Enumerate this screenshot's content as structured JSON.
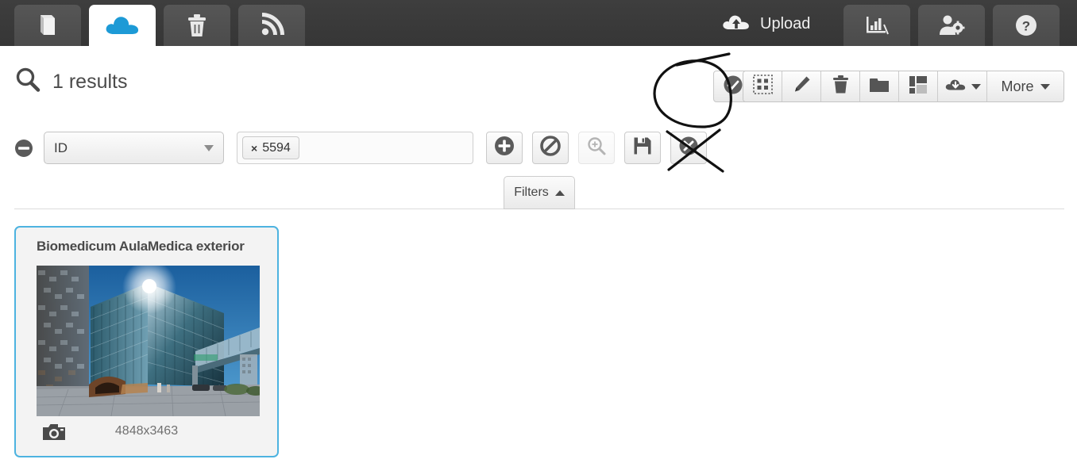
{
  "topbar": {
    "tabs_left": [
      {
        "name": "book-tab",
        "icon": "book-icon",
        "active": false
      },
      {
        "name": "cloud-tab",
        "icon": "cloud-icon",
        "active": true
      },
      {
        "name": "trash-tab",
        "icon": "trash-icon",
        "active": false
      },
      {
        "name": "feed-tab",
        "icon": "rss-icon",
        "active": false
      }
    ],
    "upload_label": "Upload",
    "upload_icon": "cloud-upload-icon",
    "tabs_right": [
      {
        "name": "stats-tab",
        "icon": "bar-chart-icon"
      },
      {
        "name": "users-tab",
        "icon": "user-settings-icon"
      },
      {
        "name": "help-tab",
        "icon": "question-circle-icon"
      }
    ]
  },
  "results": {
    "search_icon": "search-icon",
    "count_label": "1 results"
  },
  "toolbar": {
    "check_button": {
      "label": "",
      "icon": "check-circle-icon"
    },
    "buttons": [
      {
        "name": "select-all-button",
        "icon": "select-grid-icon",
        "label": ""
      },
      {
        "name": "edit-button",
        "icon": "pencil-icon",
        "label": ""
      },
      {
        "name": "delete-button",
        "icon": "trash-icon",
        "label": ""
      },
      {
        "name": "folder-button",
        "icon": "folder-icon",
        "label": ""
      },
      {
        "name": "layout-button",
        "icon": "collage-layout-icon",
        "label": ""
      },
      {
        "name": "download-dropdown",
        "icon": "cloud-download-icon",
        "label": ""
      },
      {
        "name": "more-dropdown",
        "icon": "caret-down-icon",
        "label": "More"
      }
    ]
  },
  "filters": {
    "remove_icon": "minus-circle-icon",
    "field_select": {
      "value": "ID",
      "caret": "caret-down-icon"
    },
    "tag_input": {
      "tags": [
        {
          "remove": "×",
          "label": "5594"
        }
      ],
      "placeholder": ""
    },
    "actions": [
      {
        "name": "add-filter-button",
        "icon": "plus-circle-icon",
        "disabled": false
      },
      {
        "name": "block-filter-button",
        "icon": "ban-circle-icon",
        "disabled": false
      },
      {
        "name": "zoom-search-button",
        "icon": "search-plus-icon",
        "disabled": true
      },
      {
        "name": "save-filter-button",
        "icon": "floppy-save-icon",
        "disabled": false
      },
      {
        "name": "clear-filter-button",
        "icon": "times-circle-icon",
        "disabled": false
      }
    ],
    "filters_tab_label": "Filters",
    "filters_tab_caret": "caret-up-icon"
  },
  "result_card": {
    "title": "Biomedicum AulaMedica exterior",
    "dimensions": "4848x3463",
    "media_icon": "camera-icon",
    "border_color": "#4db3e0"
  },
  "annotations": [
    {
      "name": "hand-drawn-circle",
      "target": "check-circle-button"
    },
    {
      "name": "hand-drawn-cross",
      "target": "clear-filter-button"
    }
  ],
  "colors": {
    "topbar_bg": "#3b3b3b",
    "cloud_blue": "#1d9ad6",
    "card_border": "#4db3e0",
    "text_dark": "#4a4a4a"
  }
}
